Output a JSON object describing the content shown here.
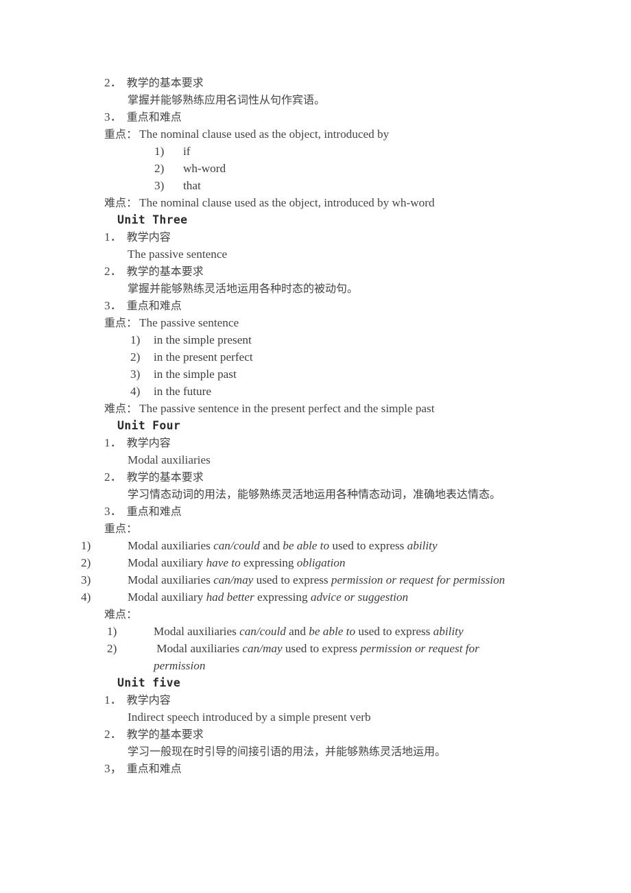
{
  "document": {
    "sections": [
      {
        "id": "unit-two-tail",
        "lines": [
          {
            "kind": "numitem",
            "num": "2．",
            "text": "教学的基本要求"
          },
          {
            "kind": "sub-cjk",
            "text": "掌握并能够熟练应用名词性从句作宾语。"
          },
          {
            "kind": "numitem",
            "num": "3．",
            "text": "重点和难点"
          },
          {
            "kind": "keyline",
            "label": "重点：",
            "body": "The nominal clause used as the object, introduced by"
          },
          {
            "kind": "list-deep",
            "marker": "1)",
            "text": "if"
          },
          {
            "kind": "list-deep",
            "marker": "2)",
            "text": "wh-word"
          },
          {
            "kind": "list-deep",
            "marker": "3)",
            "text": "that"
          },
          {
            "kind": "keyline",
            "label": "难点：",
            "body": "The nominal clause used as the object, introduced by wh-word"
          }
        ]
      },
      {
        "id": "unit-three",
        "heading": "Unit Three",
        "lines": [
          {
            "kind": "numitem",
            "num": "1．",
            "text": "教学内容"
          },
          {
            "kind": "sub-en",
            "text": "The passive sentence"
          },
          {
            "kind": "numitem",
            "num": "2．",
            "text": "教学的基本要求"
          },
          {
            "kind": "sub-cjk",
            "text": "掌握并能够熟练灵活地运用各种时态的被动句。"
          },
          {
            "kind": "numitem",
            "num": "3．",
            "text": "重点和难点"
          },
          {
            "kind": "keyline",
            "label": "重点：",
            "body": "The passive sentence"
          },
          {
            "kind": "list-mid",
            "marker": "1)",
            "text": "in the simple present"
          },
          {
            "kind": "list-mid",
            "marker": "2)",
            "text": "in the present perfect"
          },
          {
            "kind": "list-mid",
            "marker": "3)",
            "text": "in the simple past"
          },
          {
            "kind": "list-mid",
            "marker": "4)",
            "text": "in the future"
          },
          {
            "kind": "keyline",
            "label": "难点：",
            "body": "The passive sentence in the present perfect and the simple past"
          }
        ]
      },
      {
        "id": "unit-four",
        "heading": "Unit Four",
        "lines": [
          {
            "kind": "numitem",
            "num": "1．",
            "text": "教学内容"
          },
          {
            "kind": "sub-en",
            "text": "Modal auxiliaries"
          },
          {
            "kind": "numitem",
            "num": "2．",
            "text": "教学的基本要求"
          },
          {
            "kind": "cjkwrap",
            "text": "学习情态动词的用法，能够熟练灵活地运用各种情态动词，准确地表达情态。"
          },
          {
            "kind": "numitem",
            "num": "3．",
            "text": "重点和难点"
          },
          {
            "kind": "label-only",
            "label": "重点："
          }
        ],
        "key_points": [
          {
            "marker": "1)",
            "parts": [
              {
                "t": "Modal auxiliaries ",
                "i": false
              },
              {
                "t": "can/could",
                "i": true
              },
              {
                "t": " and ",
                "i": false
              },
              {
                "t": "be able to",
                "i": true
              },
              {
                "t": " used to express ",
                "i": false
              },
              {
                "t": "ability",
                "i": true
              }
            ]
          },
          {
            "marker": "2)",
            "parts": [
              {
                "t": "Modal auxiliary ",
                "i": false
              },
              {
                "t": "have to",
                "i": true
              },
              {
                "t": " expressing ",
                "i": false
              },
              {
                "t": "obligation",
                "i": true
              }
            ]
          },
          {
            "marker": "3)",
            "parts": [
              {
                "t": "Modal auxiliaries ",
                "i": false
              },
              {
                "t": "can/may",
                "i": true
              },
              {
                "t": " used to express ",
                "i": false
              },
              {
                "t": "permission or request for permission",
                "i": true
              }
            ]
          },
          {
            "marker": "4)",
            "parts": [
              {
                "t": "Modal auxiliary ",
                "i": false
              },
              {
                "t": "had better",
                "i": true
              },
              {
                "t": " expressing ",
                "i": false
              },
              {
                "t": "advice or suggestion",
                "i": true
              }
            ]
          }
        ],
        "difficult_label": "难点：",
        "difficult_points": [
          {
            "marker": "1)",
            "parts": [
              {
                "t": "Modal auxiliaries ",
                "i": false
              },
              {
                "t": "can/could",
                "i": true
              },
              {
                "t": " and ",
                "i": false
              },
              {
                "t": "be able to",
                "i": true
              },
              {
                "t": " used to express ",
                "i": false
              },
              {
                "t": "ability",
                "i": true
              }
            ]
          },
          {
            "marker": "2)",
            "parts": [
              {
                "t": " Modal auxiliaries ",
                "i": false
              },
              {
                "t": "can/may",
                "i": true
              },
              {
                "t": " used to express ",
                "i": false
              },
              {
                "t": "permission or request for permission",
                "i": true
              }
            ]
          }
        ]
      },
      {
        "id": "unit-five",
        "heading": "Unit five",
        "lines": [
          {
            "kind": "numitem",
            "num": "1．",
            "text": "教学内容"
          },
          {
            "kind": "sub-en",
            "text": "Indirect speech introduced by a simple present verb"
          },
          {
            "kind": "numitem",
            "num": "2．",
            "text": "教学的基本要求"
          },
          {
            "kind": "sub-cjk",
            "text": "学习一般现在时引导的间接引语的用法，并能够熟练灵活地运用。"
          },
          {
            "kind": "numitem",
            "num": "3，",
            "text": "重点和难点"
          }
        ]
      }
    ]
  }
}
